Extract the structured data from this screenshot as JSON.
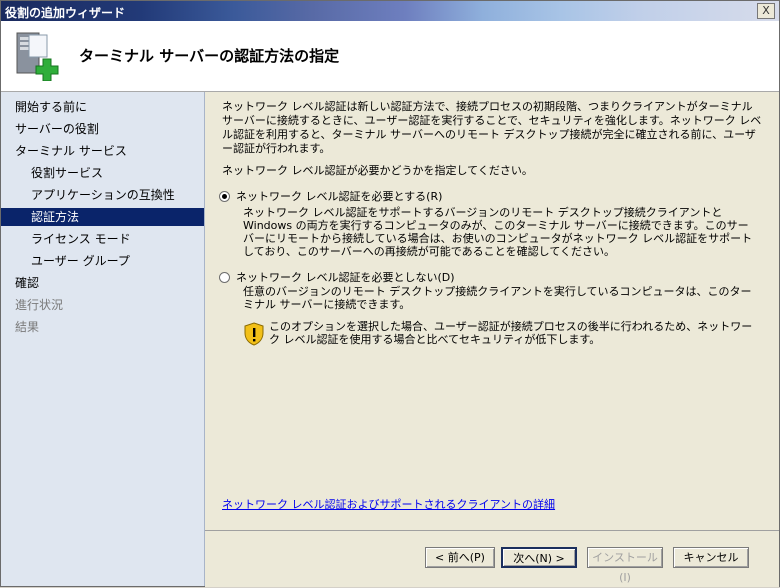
{
  "window": {
    "title": "役割の追加ウィザード",
    "close_label": "X"
  },
  "header": {
    "title": "ターミナル サーバーの認証方法の指定"
  },
  "sidebar": {
    "items": [
      {
        "label": "開始する前に",
        "state": "normal"
      },
      {
        "label": "サーバーの役割",
        "state": "normal"
      },
      {
        "label": "ターミナル サービス",
        "state": "normal"
      },
      {
        "label": "役割サービス",
        "state": "normal"
      },
      {
        "label": "アプリケーションの互換性",
        "state": "normal"
      },
      {
        "label": "認証方法",
        "state": "active"
      },
      {
        "label": "ライセンス モード",
        "state": "normal"
      },
      {
        "label": "ユーザー グループ",
        "state": "normal"
      },
      {
        "label": "確認",
        "state": "normal"
      },
      {
        "label": "進行状況",
        "state": "disabled"
      },
      {
        "label": "結果",
        "state": "disabled"
      }
    ]
  },
  "content": {
    "description": "ネットワーク レベル認証は新しい認証方法で、接続プロセスの初期段階、つまりクライアントがターミナル サーバーに接続するときに、ユーザー認証を実行することで、セキュリティを強化します。ネットワーク レベル認証を利用すると、ターミナル サーバーへのリモート デスクトップ接続が完全に確立される前に、ユーザー認証が行われます。",
    "question": "ネットワーク レベル認証が必要かどうかを指定してください。",
    "option_require": {
      "label": "ネットワーク レベル認証を必要とする(R)",
      "checked": true,
      "detail": "ネットワーク レベル認証をサポートするバージョンのリモート デスクトップ接続クライアントと Windows の両方を実行するコンピュータのみが、このターミナル サーバーに接続できます。このサーバーにリモートから接続している場合は、お使いのコンピュータがネットワーク レベル認証をサポートしており、このサーバーへの再接続が可能であることを確認してください。"
    },
    "option_not_require": {
      "label": "ネットワーク レベル認証を必要としない(D)",
      "checked": false,
      "detail": "任意のバージョンのリモート デスクトップ接続クライアントを実行しているコンピュータは、このターミナル サーバーに接続できます。"
    },
    "warning": "このオプションを選択した場合、ユーザー認証が接続プロセスの後半に行われるため、ネットワーク レベル認証を使用する場合と比べてセキュリティが低下します。",
    "link": "ネットワーク レベル認証およびサポートされるクライアントの詳細"
  },
  "footer": {
    "back_label": "< 前へ(P)",
    "next_label": "次へ(N) >",
    "install_label": "インストール(I)",
    "cancel_label": "キャンセル"
  },
  "colors": {
    "active_nav": "#0a246a",
    "link": "#0000ee",
    "sidebar_bg": "#dfe6f0"
  },
  "icons": {
    "header": "server-role-add-icon",
    "warning": "shield-warning-icon"
  }
}
